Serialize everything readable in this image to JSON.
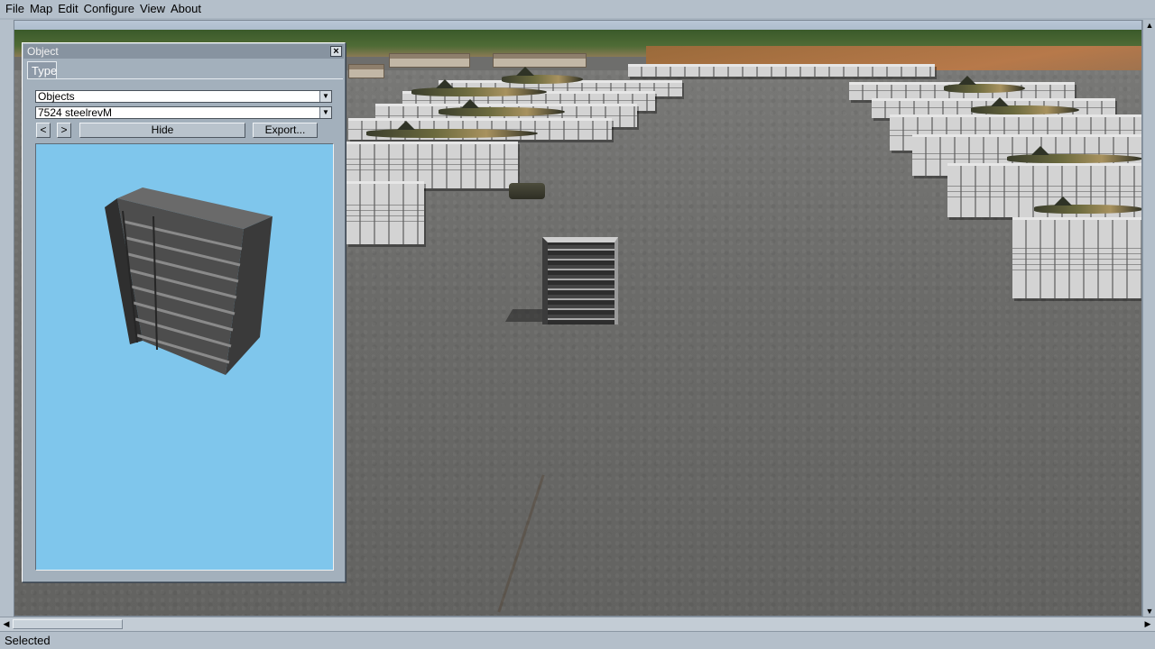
{
  "menu": [
    "File",
    "Map",
    "Edit",
    "Configure",
    "View",
    "About"
  ],
  "panel": {
    "title": "Object",
    "close_glyph": "×",
    "tab": "Type",
    "category_select": "Objects",
    "object_select": "7524 steelrevM",
    "prev_label": "<",
    "next_label": ">",
    "hide_label": "Hide",
    "export_label": "Export...",
    "dropdown_glyph": "▼"
  },
  "scroll": {
    "up": "▲",
    "down": "▼",
    "left": "◀",
    "right": "▶"
  },
  "status": {
    "text": "Selected"
  },
  "colors": {
    "preview_bg": "#7fc6ec",
    "panel_bg": "#a3b0bc",
    "chrome": "#b4bfca"
  }
}
